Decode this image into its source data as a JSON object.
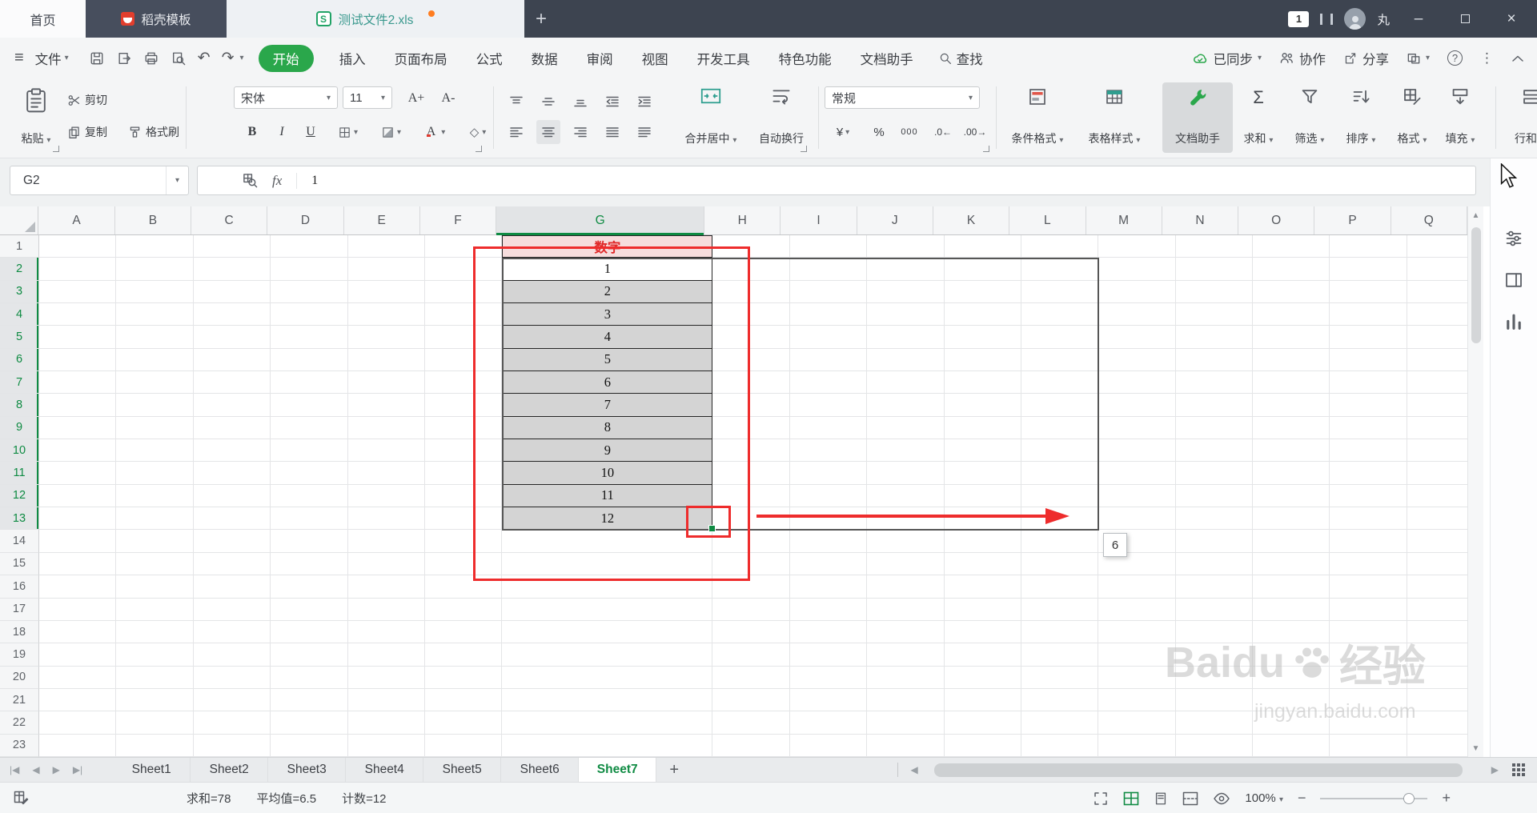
{
  "titlebar": {
    "home_tab": "首页",
    "docer_tab": "稻壳模板",
    "document_tab": "测试文件2.xls",
    "doc_icon": "S",
    "new_tab": "+",
    "message_count": "1",
    "user_name": "丸",
    "minimize": "–",
    "close": "×"
  },
  "menubar": {
    "file_label": "文件",
    "start_label": "开始",
    "items": [
      "插入",
      "页面布局",
      "公式",
      "数据",
      "审阅",
      "视图",
      "开发工具",
      "特色功能",
      "文档助手"
    ],
    "search_label": "查找",
    "synced_label": "已同步",
    "collab_label": "协作",
    "share_label": "分享",
    "help_label": "?"
  },
  "toolbar": {
    "paste": "粘贴",
    "cut": "剪切",
    "copy": "复制",
    "format_painter": "格式刷",
    "font_name": "宋体",
    "font_size": "11",
    "font_bigger": "A+",
    "font_smaller": "A-",
    "bold": "B",
    "italic": "I",
    "underline": "U",
    "merge_center": "合并居中",
    "wrap_text": "自动换行",
    "number_format": "常规",
    "currency": "¥",
    "percent": "%",
    "comma": "000",
    "dec_increase": ".0",
    "dec_decrease": ".00",
    "conditional_format": "条件格式",
    "table_style": "表格样式",
    "doc_assistant": "文档助手",
    "sum": "求和",
    "filter": "筛选",
    "sort": "排序",
    "format": "格式",
    "fill": "填充",
    "rows_cols": "行和列"
  },
  "formula_bar": {
    "name_box": "G2",
    "fx": "fx",
    "value": "1"
  },
  "grid": {
    "columns": [
      "A",
      "B",
      "C",
      "D",
      "E",
      "F",
      "G",
      "H",
      "I",
      "J",
      "K",
      "L",
      "M",
      "N",
      "O",
      "P",
      "Q"
    ],
    "row_count": 23,
    "selected_column": "G",
    "selected_rows_start": 2,
    "selected_rows_end": 13,
    "table": {
      "header": "数字",
      "values": [
        "1",
        "2",
        "3",
        "4",
        "5",
        "6",
        "7",
        "8",
        "9",
        "10",
        "11",
        "12"
      ]
    },
    "fill_tooltip": "6"
  },
  "sheet_bar": {
    "tabs": [
      "Sheet1",
      "Sheet2",
      "Sheet3",
      "Sheet4",
      "Sheet5",
      "Sheet6",
      "Sheet7"
    ],
    "active_tab": "Sheet7",
    "add_tab": "+"
  },
  "status_bar": {
    "sum": "求和=78",
    "average": "平均值=6.5",
    "count": "计数=12",
    "zoom": "100%"
  },
  "watermark": {
    "brand_left": "Baidu",
    "brand_right": "经验",
    "url": "jingyan.baidu.com"
  },
  "colors": {
    "accent_green": "#0f8b43",
    "start_green": "#2aa74b",
    "annotation_red": "#ee2c2c",
    "selection_border": "#565656",
    "table_cell_bg": "#d4d4d4",
    "table_header_bg": "#f6dddd",
    "table_header_text": "#e02a2a"
  }
}
